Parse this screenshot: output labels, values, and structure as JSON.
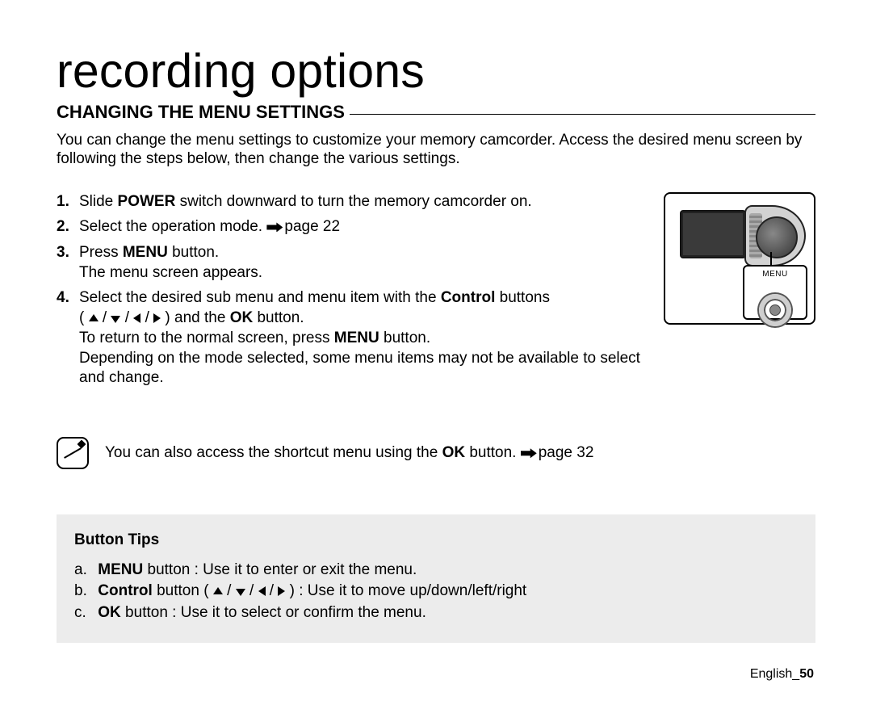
{
  "title": "recording options",
  "section_heading": "CHANGING THE MENU SETTINGS",
  "intro": "You can change the menu settings to customize your memory camcorder. Access the desired menu screen by following the steps below, then change the various settings.",
  "steps": {
    "s1": {
      "num": "1.",
      "pre": "Slide ",
      "bold": "POWER",
      "post": " switch downward to turn the memory camcorder on."
    },
    "s2": {
      "num": "2.",
      "text": "Select the operation mode. ",
      "pageref": "page 22"
    },
    "s3": {
      "num": "3.",
      "pre": "Press ",
      "bold": "MENU",
      "post": " button.",
      "sub": "The menu screen appears."
    },
    "s4": {
      "num": "4.",
      "l1_pre": "Select the desired sub menu and menu item with the ",
      "l1_bold": "Control",
      "l1_post": " buttons",
      "l2_pre": "( ",
      "l2_mid": " ) and the ",
      "l2_bold": "OK",
      "l2_post": " button.",
      "l3_pre": "To return to the normal screen, press ",
      "l3_bold": "MENU",
      "l3_post": " button.",
      "l4": "Depending on the mode selected, some menu items may not be available to select and change."
    }
  },
  "note": {
    "pre": "You can also access the shortcut menu using the ",
    "bold": "OK",
    "mid": " button. ",
    "pageref": "page 32"
  },
  "illustration": {
    "menu_label": "MENU"
  },
  "tips": {
    "title": "Button Tips",
    "a": {
      "lbl": "a.",
      "bold": "MENU",
      "rest": " button : Use it to enter or exit the menu."
    },
    "b": {
      "lbl": "b.",
      "bold": "Control",
      "pre": " button ( ",
      "post": " ) : Use it to move up/down/left/right"
    },
    "c": {
      "lbl": "c.",
      "bold": "OK",
      "rest": " button : Use it to select or confirm the menu."
    }
  },
  "footer": {
    "lang": "English",
    "sep": "_",
    "page": "50"
  }
}
